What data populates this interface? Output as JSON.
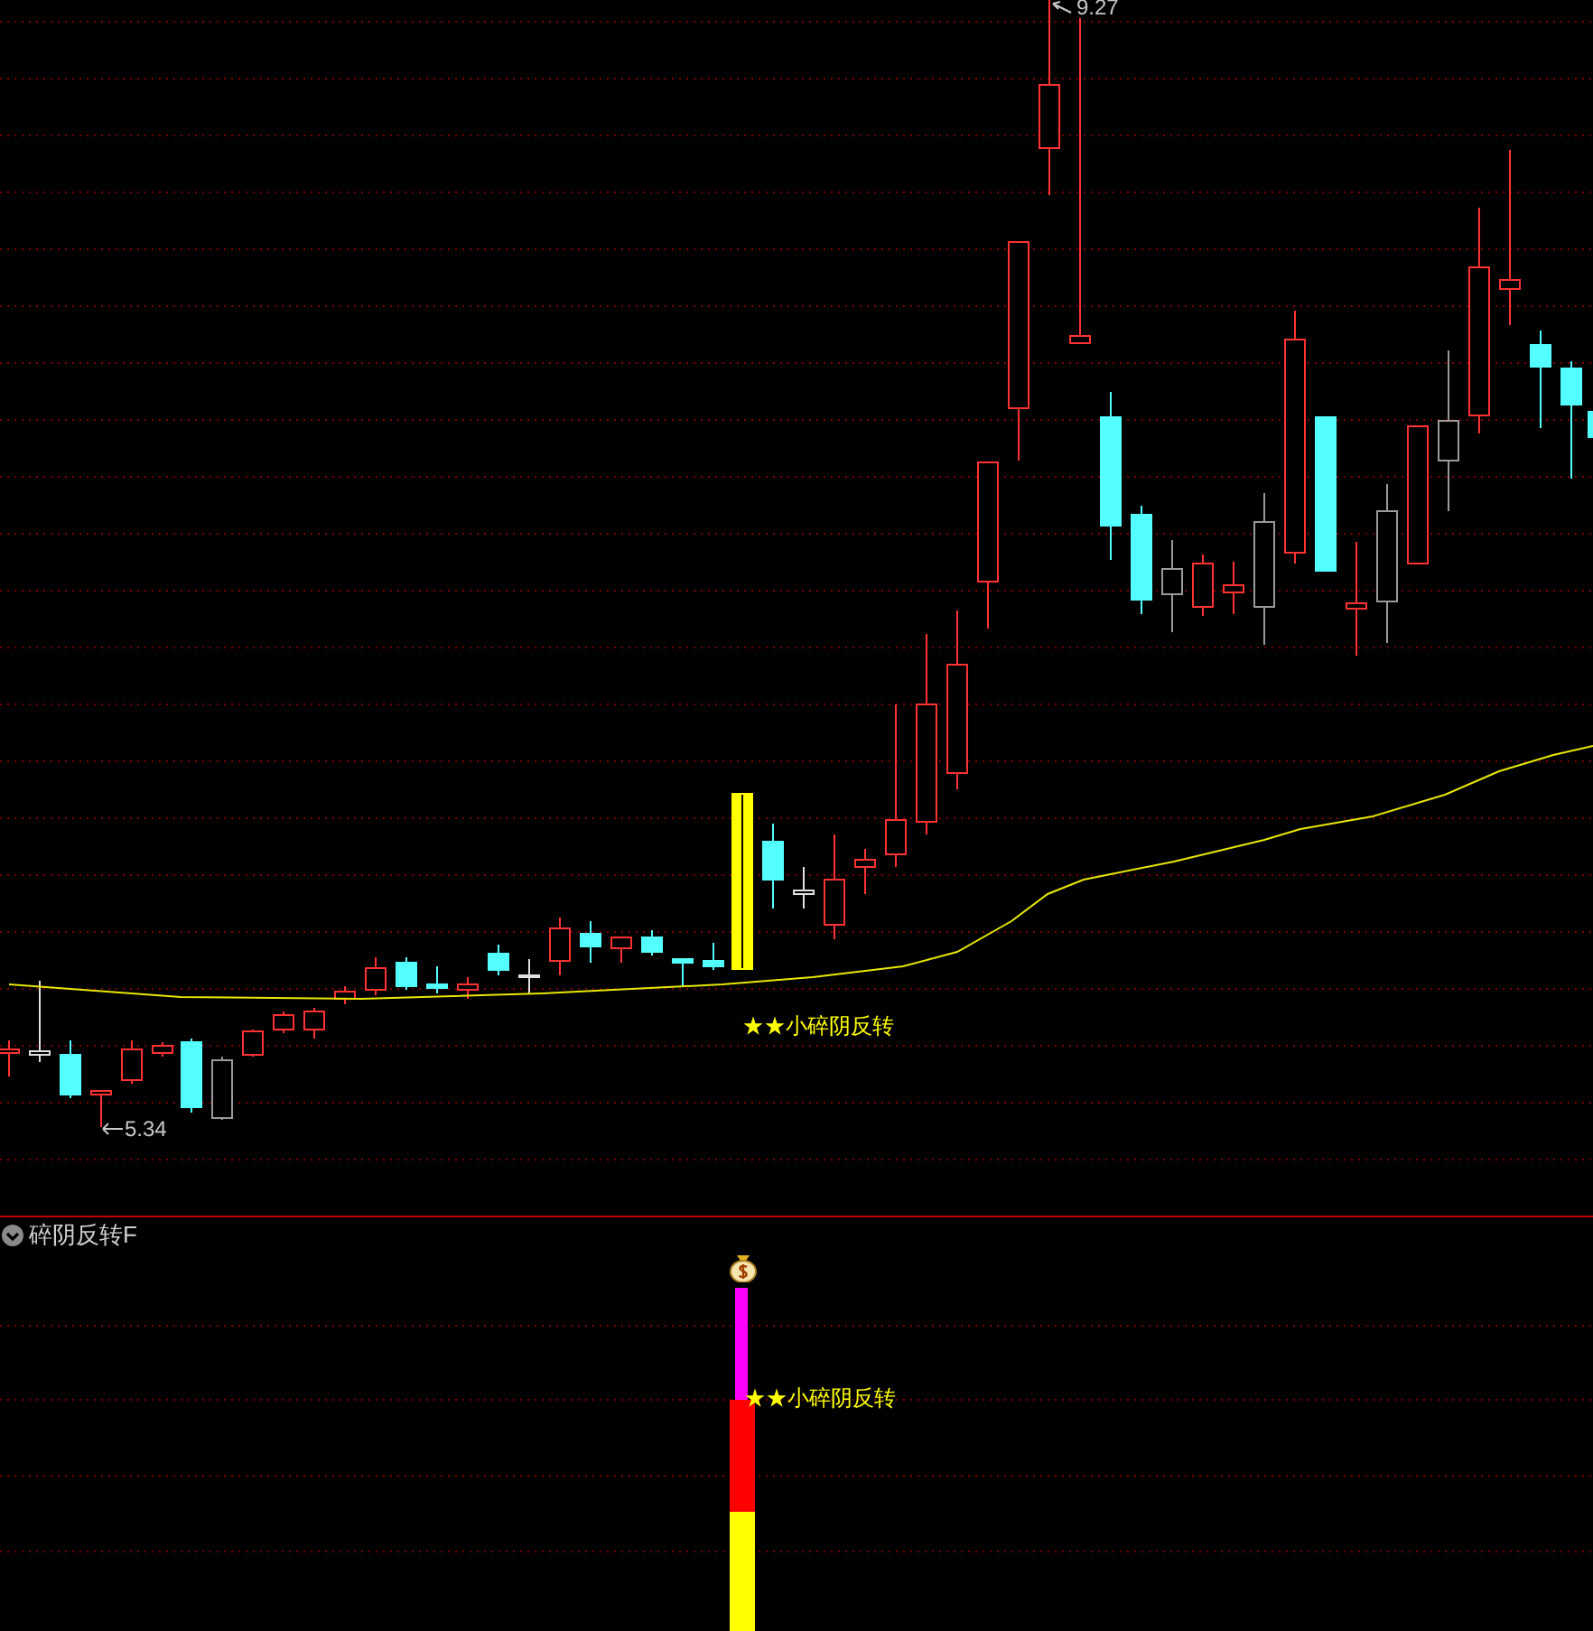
{
  "price_chart": {
    "high_label": "9.27",
    "low_label": "5.34",
    "signal_label": "★★小碎阴反转"
  },
  "indicator": {
    "title": "碎阴反转F",
    "signal_label": "★★小碎阴反转"
  }
}
